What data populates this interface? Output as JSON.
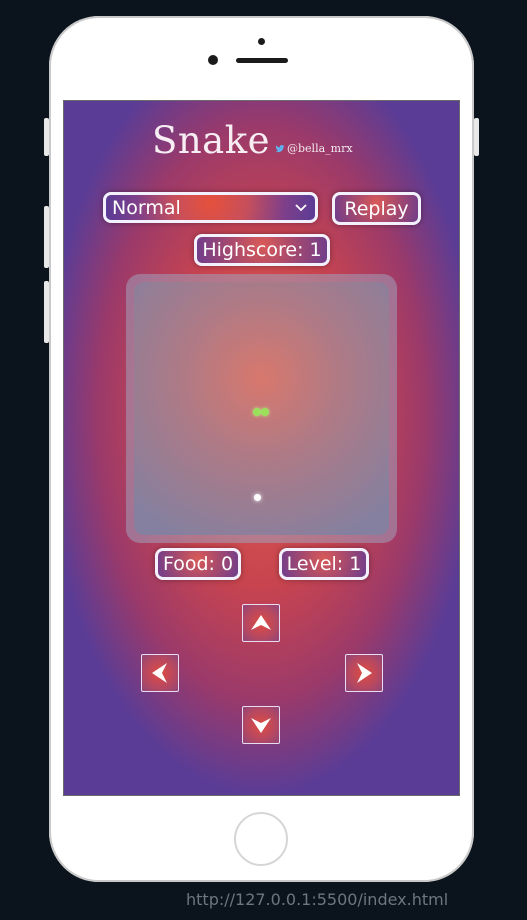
{
  "game": {
    "title": "Snake",
    "handle": "@bella_mrx",
    "difficulty": {
      "selected": "Normal"
    },
    "replay_label": "Replay",
    "highscore_text": "Highscore: 1",
    "food_text": "Food: 0",
    "level_text": "Level: 1",
    "controls": {
      "up": "arrow-up-icon",
      "left": "arrow-left-icon",
      "right": "arrow-right-icon",
      "down": "arrow-down-icon"
    }
  },
  "browser": {
    "url": "http://127.0.0.1:5500/index.html"
  },
  "colors": {
    "snake": "#9be05a",
    "food": "#ffffff",
    "border": "#f4f1ff"
  }
}
